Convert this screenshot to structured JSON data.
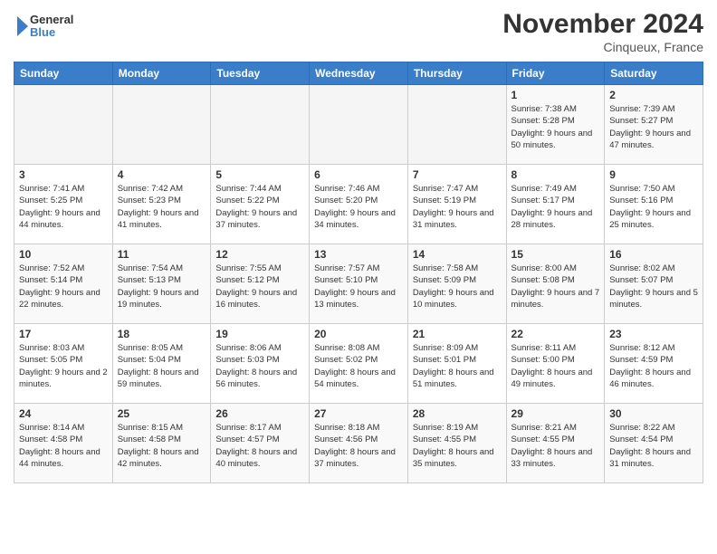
{
  "header": {
    "logo_general": "General",
    "logo_blue": "Blue",
    "month_title": "November 2024",
    "location": "Cinqueux, France"
  },
  "weekdays": [
    "Sunday",
    "Monday",
    "Tuesday",
    "Wednesday",
    "Thursday",
    "Friday",
    "Saturday"
  ],
  "weeks": [
    [
      {
        "day": "",
        "info": ""
      },
      {
        "day": "",
        "info": ""
      },
      {
        "day": "",
        "info": ""
      },
      {
        "day": "",
        "info": ""
      },
      {
        "day": "",
        "info": ""
      },
      {
        "day": "1",
        "info": "Sunrise: 7:38 AM\nSunset: 5:28 PM\nDaylight: 9 hours and 50 minutes."
      },
      {
        "day": "2",
        "info": "Sunrise: 7:39 AM\nSunset: 5:27 PM\nDaylight: 9 hours and 47 minutes."
      }
    ],
    [
      {
        "day": "3",
        "info": "Sunrise: 7:41 AM\nSunset: 5:25 PM\nDaylight: 9 hours and 44 minutes."
      },
      {
        "day": "4",
        "info": "Sunrise: 7:42 AM\nSunset: 5:23 PM\nDaylight: 9 hours and 41 minutes."
      },
      {
        "day": "5",
        "info": "Sunrise: 7:44 AM\nSunset: 5:22 PM\nDaylight: 9 hours and 37 minutes."
      },
      {
        "day": "6",
        "info": "Sunrise: 7:46 AM\nSunset: 5:20 PM\nDaylight: 9 hours and 34 minutes."
      },
      {
        "day": "7",
        "info": "Sunrise: 7:47 AM\nSunset: 5:19 PM\nDaylight: 9 hours and 31 minutes."
      },
      {
        "day": "8",
        "info": "Sunrise: 7:49 AM\nSunset: 5:17 PM\nDaylight: 9 hours and 28 minutes."
      },
      {
        "day": "9",
        "info": "Sunrise: 7:50 AM\nSunset: 5:16 PM\nDaylight: 9 hours and 25 minutes."
      }
    ],
    [
      {
        "day": "10",
        "info": "Sunrise: 7:52 AM\nSunset: 5:14 PM\nDaylight: 9 hours and 22 minutes."
      },
      {
        "day": "11",
        "info": "Sunrise: 7:54 AM\nSunset: 5:13 PM\nDaylight: 9 hours and 19 minutes."
      },
      {
        "day": "12",
        "info": "Sunrise: 7:55 AM\nSunset: 5:12 PM\nDaylight: 9 hours and 16 minutes."
      },
      {
        "day": "13",
        "info": "Sunrise: 7:57 AM\nSunset: 5:10 PM\nDaylight: 9 hours and 13 minutes."
      },
      {
        "day": "14",
        "info": "Sunrise: 7:58 AM\nSunset: 5:09 PM\nDaylight: 9 hours and 10 minutes."
      },
      {
        "day": "15",
        "info": "Sunrise: 8:00 AM\nSunset: 5:08 PM\nDaylight: 9 hours and 7 minutes."
      },
      {
        "day": "16",
        "info": "Sunrise: 8:02 AM\nSunset: 5:07 PM\nDaylight: 9 hours and 5 minutes."
      }
    ],
    [
      {
        "day": "17",
        "info": "Sunrise: 8:03 AM\nSunset: 5:05 PM\nDaylight: 9 hours and 2 minutes."
      },
      {
        "day": "18",
        "info": "Sunrise: 8:05 AM\nSunset: 5:04 PM\nDaylight: 8 hours and 59 minutes."
      },
      {
        "day": "19",
        "info": "Sunrise: 8:06 AM\nSunset: 5:03 PM\nDaylight: 8 hours and 56 minutes."
      },
      {
        "day": "20",
        "info": "Sunrise: 8:08 AM\nSunset: 5:02 PM\nDaylight: 8 hours and 54 minutes."
      },
      {
        "day": "21",
        "info": "Sunrise: 8:09 AM\nSunset: 5:01 PM\nDaylight: 8 hours and 51 minutes."
      },
      {
        "day": "22",
        "info": "Sunrise: 8:11 AM\nSunset: 5:00 PM\nDaylight: 8 hours and 49 minutes."
      },
      {
        "day": "23",
        "info": "Sunrise: 8:12 AM\nSunset: 4:59 PM\nDaylight: 8 hours and 46 minutes."
      }
    ],
    [
      {
        "day": "24",
        "info": "Sunrise: 8:14 AM\nSunset: 4:58 PM\nDaylight: 8 hours and 44 minutes."
      },
      {
        "day": "25",
        "info": "Sunrise: 8:15 AM\nSunset: 4:58 PM\nDaylight: 8 hours and 42 minutes."
      },
      {
        "day": "26",
        "info": "Sunrise: 8:17 AM\nSunset: 4:57 PM\nDaylight: 8 hours and 40 minutes."
      },
      {
        "day": "27",
        "info": "Sunrise: 8:18 AM\nSunset: 4:56 PM\nDaylight: 8 hours and 37 minutes."
      },
      {
        "day": "28",
        "info": "Sunrise: 8:19 AM\nSunset: 4:55 PM\nDaylight: 8 hours and 35 minutes."
      },
      {
        "day": "29",
        "info": "Sunrise: 8:21 AM\nSunset: 4:55 PM\nDaylight: 8 hours and 33 minutes."
      },
      {
        "day": "30",
        "info": "Sunrise: 8:22 AM\nSunset: 4:54 PM\nDaylight: 8 hours and 31 minutes."
      }
    ]
  ]
}
